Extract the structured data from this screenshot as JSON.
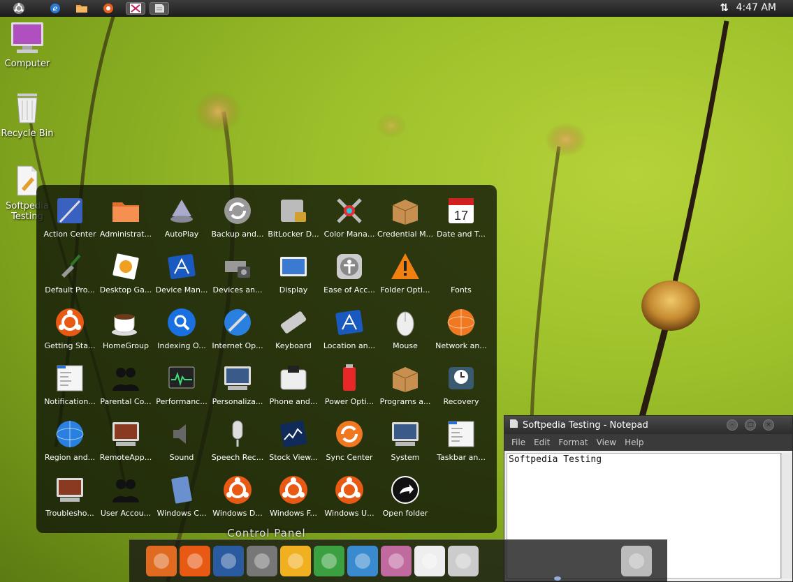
{
  "top_panel": {
    "clock": "4:47 AM",
    "icons": [
      "ubuntu-logo-icon",
      "internet-explorer-icon",
      "folder-icon",
      "media-player-icon",
      "paint-icon",
      "notepad-icon"
    ]
  },
  "desktop": {
    "computer": "Computer",
    "recycle_bin": "Recycle Bin",
    "softpedia_line1": "Softpedia",
    "softpedia_line2": "Testing"
  },
  "control_panel": {
    "title": "Control Panel",
    "items": [
      {
        "label": "Action Center",
        "icon": "action-center-icon"
      },
      {
        "label": "Administrat...",
        "icon": "folder-icon"
      },
      {
        "label": "AutoPlay",
        "icon": "autoplay-icon"
      },
      {
        "label": "Backup and...",
        "icon": "backup-icon"
      },
      {
        "label": "BitLocker D...",
        "icon": "bitlocker-icon"
      },
      {
        "label": "Color Mana...",
        "icon": "color-management-icon"
      },
      {
        "label": "Credential M...",
        "icon": "credential-manager-icon"
      },
      {
        "label": "Date and T...",
        "icon": "calendar-icon"
      },
      {
        "label": "Default Pro...",
        "icon": "default-programs-icon"
      },
      {
        "label": "Desktop Ga...",
        "icon": "desktop-gadgets-icon"
      },
      {
        "label": "Device Man...",
        "icon": "device-manager-icon"
      },
      {
        "label": "Devices an...",
        "icon": "devices-printers-icon"
      },
      {
        "label": "Display",
        "icon": "display-icon"
      },
      {
        "label": "Ease of Acc...",
        "icon": "accessibility-icon"
      },
      {
        "label": "Folder Opti...",
        "icon": "warning-icon"
      },
      {
        "label": "Fonts",
        "icon": "fonts-icon"
      },
      {
        "label": "Getting Sta...",
        "icon": "ubuntu-logo-icon"
      },
      {
        "label": "HomeGroup",
        "icon": "coffee-cup-icon"
      },
      {
        "label": "Indexing O...",
        "icon": "search-icon"
      },
      {
        "label": "Internet Op...",
        "icon": "globe-tools-icon"
      },
      {
        "label": "Keyboard",
        "icon": "keyboard-icon"
      },
      {
        "label": "Location an...",
        "icon": "location-icon"
      },
      {
        "label": "Mouse",
        "icon": "mouse-icon"
      },
      {
        "label": "Network an...",
        "icon": "network-icon"
      },
      {
        "label": "Notification...",
        "icon": "notification-icon"
      },
      {
        "label": "Parental Co...",
        "icon": "users-icon"
      },
      {
        "label": "Performanc...",
        "icon": "performance-icon"
      },
      {
        "label": "Personaliza...",
        "icon": "monitor-icon"
      },
      {
        "label": "Phone and...",
        "icon": "phone-icon"
      },
      {
        "label": "Power Opti...",
        "icon": "battery-icon"
      },
      {
        "label": "Programs a...",
        "icon": "package-icon"
      },
      {
        "label": "Recovery",
        "icon": "recovery-icon"
      },
      {
        "label": "Region and...",
        "icon": "globe-icon"
      },
      {
        "label": "RemoteApp...",
        "icon": "remote-desktop-icon"
      },
      {
        "label": "Sound",
        "icon": "speaker-icon"
      },
      {
        "label": "Speech Rec...",
        "icon": "microphone-icon"
      },
      {
        "label": "Stock View...",
        "icon": "stock-chart-icon"
      },
      {
        "label": "Sync Center",
        "icon": "sync-icon"
      },
      {
        "label": "System",
        "icon": "computer-icon"
      },
      {
        "label": "Taskbar an...",
        "icon": "taskbar-icon"
      },
      {
        "label": "Troublesho...",
        "icon": "troubleshoot-icon"
      },
      {
        "label": "User Accou...",
        "icon": "users-icon"
      },
      {
        "label": "Windows C...",
        "icon": "windows-cardspace-icon"
      },
      {
        "label": "Windows D...",
        "icon": "ubuntu-logo-icon"
      },
      {
        "label": "Windows F...",
        "icon": "ubuntu-logo-icon"
      },
      {
        "label": "Windows U...",
        "icon": "ubuntu-logo-icon"
      },
      {
        "label": "Open folder",
        "icon": "open-folder-icon"
      }
    ]
  },
  "notepad": {
    "title": "Softpedia Testing - Notepad",
    "menu": [
      "File",
      "Edit",
      "Format",
      "View",
      "Help"
    ],
    "content": "Softpedia Testing"
  },
  "dock": {
    "items": [
      "firefox-icon",
      "ubuntu-logo-icon",
      "paint-icon",
      "gear-icon",
      "users-icon",
      "chrome-icon",
      "itunes-icon",
      "paint-palette-icon",
      "notepad-icon",
      "calculator-icon",
      "trash-icon"
    ]
  },
  "colors": {
    "accent": "#f07020",
    "panel": "#1e1e1e"
  }
}
